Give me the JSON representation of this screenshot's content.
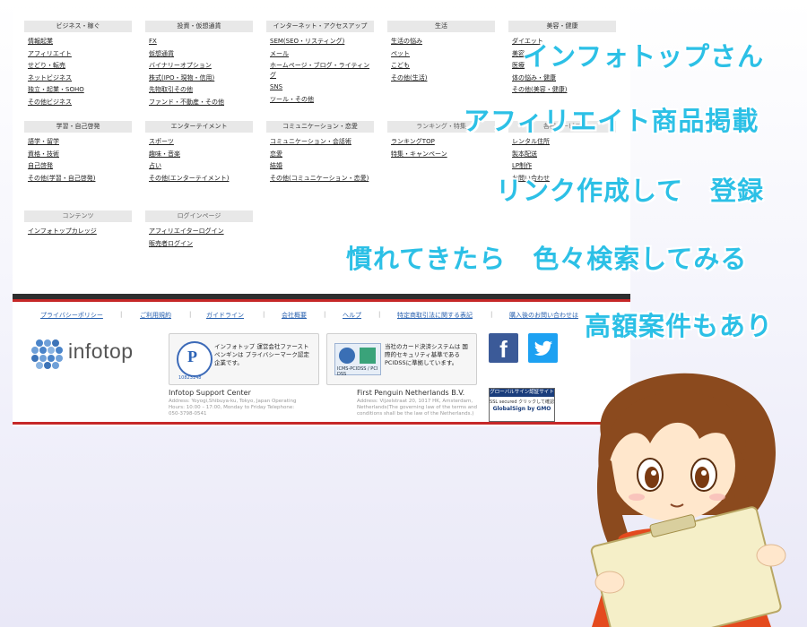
{
  "categories": [
    {
      "title": "ビジネス・稼ぐ",
      "items": [
        "情報起業",
        "アフィリエイト",
        "せどり・転売",
        "ネットビジネス",
        "独立・起業・SOHO",
        "その他ビジネス"
      ]
    },
    {
      "title": "投資・仮想通貨",
      "items": [
        "FX",
        "仮想通貨",
        "バイナリーオプション",
        "株式(IPO・現物・信用)",
        "先物取引その他",
        "ファンド・不動産・その他"
      ]
    },
    {
      "title": "インターネット・アクセスアップ",
      "items": [
        "SEM(SEO・リスティング)",
        "メール",
        "ホームページ・ブログ・ライティング",
        "SNS",
        "ツール・その他"
      ]
    },
    {
      "title": "生活",
      "items": [
        "生活の悩み",
        "ペット",
        "こども",
        "その他(生活)"
      ]
    },
    {
      "title": "美容・健康",
      "items": [
        "ダイエット",
        "美容",
        "医療",
        "体の悩み・健康",
        "その他(美容・健康)"
      ]
    },
    {
      "title": "学習・自己啓発",
      "items": [
        "語学・留学",
        "資格・技術",
        "自己啓発",
        "その他(学習・自己啓発)"
      ]
    },
    {
      "title": "エンターテイメント",
      "items": [
        "スポーツ",
        "趣味・音楽",
        "占い",
        "その他(エンターテイメント)"
      ]
    },
    {
      "title": "コミュニケーション・恋愛",
      "items": [
        "コミュニケーション・会話術",
        "恋愛",
        "結婚",
        "その他(コミュニケーション・恋愛)"
      ]
    },
    {
      "title": "ランキング・特集",
      "items": [
        "ランキングTOP",
        "特集・キャンペーン"
      ]
    },
    {
      "title": "各種サービス",
      "items": [
        "レンタル住所",
        "製本配送",
        "LP制作",
        "お問い合わせ"
      ]
    },
    {
      "title": "コンテンツ",
      "items": [
        "インフォトップカレッジ"
      ]
    },
    {
      "title": "ログインページ",
      "items": [
        "アフィリエイターログイン",
        "販売者ログイン"
      ]
    }
  ],
  "footer_nav": [
    "プライバシーポリシー",
    "ご利用規約",
    "ガイドライン",
    "会社概要",
    "ヘルプ",
    "特定商取引法に関する表記",
    "購入後のお問い合わせは"
  ],
  "logo_text": "infotop",
  "privacy_mark": {
    "number": "10823148",
    "text": "インフォトップ 運営会社ファーストペンギンは プライバシーマーク認定企業です。"
  },
  "pci": {
    "caption": "ICMS-PCIDSS / PCI DSS",
    "text": "当社のカード決済システムは 国際的セキュリティ基準である PCIDSSに準拠しています。"
  },
  "sns": {
    "facebook": "f",
    "twitter": "🐦"
  },
  "office_jp": {
    "name": "Infotop Support Center",
    "addr": "Address: Yoyogi,Shibuya-ku, Tokyo, Japan Operating Hours: 10:00 – 17:00, Monday to Friday Telephone: 050-3798-0541"
  },
  "office_nl": {
    "name": "First Penguin Netherlands B.V.",
    "addr": "Address: Vijzelstraat 20, 1017 HK, Amsterdam, Netherlands(The governing law of the terms and conditions shall be the law of the Netherlands.)"
  },
  "globalsign": {
    "top": "グローバルサイン認証サイト",
    "mid": "SSL secured クリックして確認",
    "bot": "GlobalSign by GMO"
  },
  "overlay": [
    "インフォトップさん",
    "アフィリエイト商品掲載",
    "リンク作成して　登録",
    "慣れてきたら　色々検索してみる",
    "高額案件もあり"
  ]
}
